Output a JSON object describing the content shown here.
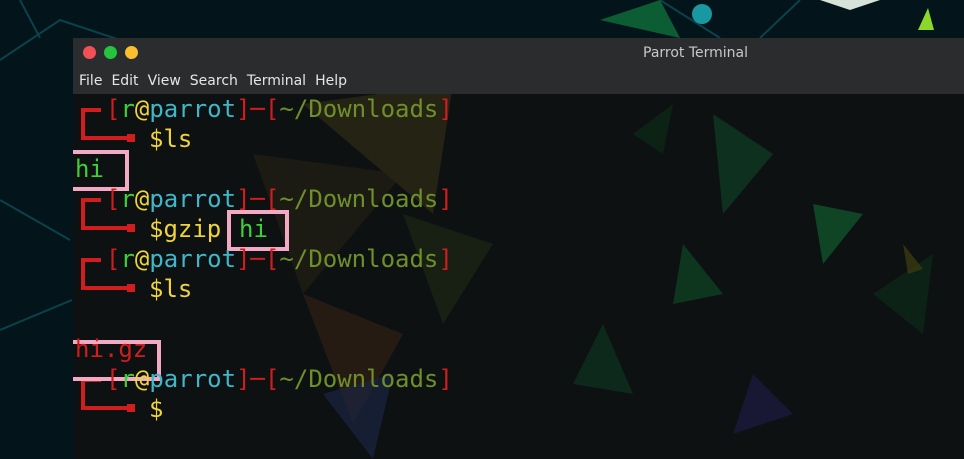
{
  "window": {
    "title": "Parrot Terminal",
    "controls": {
      "close_color": "#f25056",
      "minimize_color": "#24c43f",
      "maximize_color": "#f9bf2f"
    }
  },
  "menu": [
    "File",
    "Edit",
    "View",
    "Search",
    "Terminal",
    "Help"
  ],
  "prompt": {
    "user": "r",
    "at": "@",
    "host": "parrot",
    "dir": "~/Downloads",
    "symbol": "$"
  },
  "session": {
    "cmd1": "ls",
    "out1": "hi",
    "cmd2": "gzip",
    "cmd2_arg": "hi",
    "cmd3": "ls",
    "out3": "hi.gz"
  },
  "colors": {
    "prompt_bracket": "#d11d1d",
    "user": "#3fcf3a",
    "host": "#3fb7c9",
    "dir": "#6e8f2a",
    "dollar": "#f0d43a",
    "highlight_box": "#f2a9c4"
  }
}
